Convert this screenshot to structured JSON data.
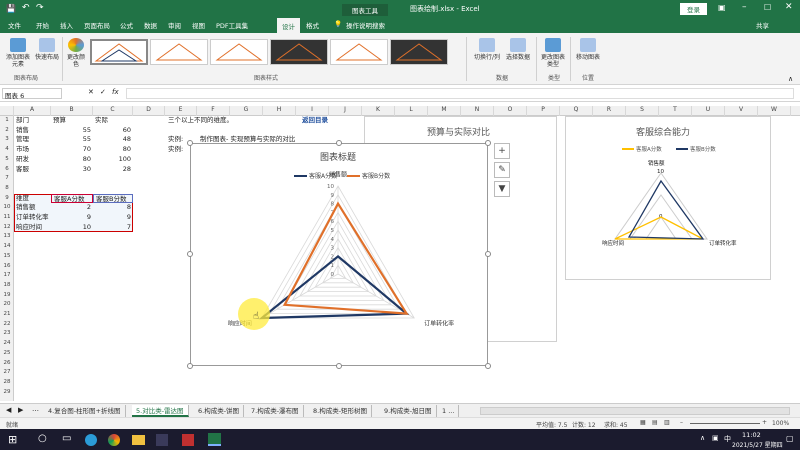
{
  "title_bar": {
    "context_tab": "图表工具",
    "filename": "图表绘制.xlsx - Excel",
    "login": "登录"
  },
  "tabs": [
    "文件",
    "开始",
    "插入",
    "页面布局",
    "公式",
    "数据",
    "审阅",
    "视图",
    "PDF工具集",
    "设计",
    "格式"
  ],
  "tell_me": "操作说明搜索",
  "share": "共享",
  "ribbon": {
    "add_element": "添加图表元素",
    "quick_layout": "快速布局",
    "change_color": "更改颜色",
    "group_layout": "图表布局",
    "group_styles": "图表样式",
    "switch_rowcol": "切换行/列",
    "select_data": "选择数据",
    "group_data": "数据",
    "change_type": "更改图表类型",
    "group_type": "类型",
    "move_chart": "移动图表",
    "group_location": "位置"
  },
  "name_box": "图表 6",
  "fx": "fx",
  "columns": [
    "A",
    "B",
    "C",
    "D",
    "E",
    "F",
    "G",
    "H",
    "I",
    "J",
    "K",
    "L",
    "M",
    "N",
    "O",
    "P",
    "Q",
    "R",
    "S",
    "T",
    "U",
    "V",
    "W"
  ],
  "rows": [
    "1",
    "2",
    "3",
    "4",
    "5",
    "6",
    "7",
    "8",
    "9",
    "10",
    "11",
    "12",
    "13",
    "14",
    "15",
    "16",
    "17",
    "18",
    "19",
    "20",
    "21",
    "22",
    "23",
    "24",
    "25",
    "26",
    "27",
    "28",
    "29"
  ],
  "table1": {
    "headers": [
      "部门",
      "预算",
      "实际"
    ],
    "rows": [
      [
        "销售",
        "55",
        "60"
      ],
      [
        "管理",
        "55",
        "48"
      ],
      [
        "市场",
        "70",
        "80"
      ],
      [
        "研发",
        "80",
        "100"
      ],
      [
        "客服",
        "30",
        "28"
      ]
    ]
  },
  "table2": {
    "headers": [
      "维度",
      "客服A分数",
      "客服B分数"
    ],
    "rows": [
      [
        "销售额",
        "2",
        "8"
      ],
      [
        "订单转化率",
        "9",
        "9"
      ],
      [
        "响应时间",
        "10",
        "7"
      ]
    ]
  },
  "notes": {
    "line1": "三个以上不同的维度。",
    "return_link": "返回目录",
    "example1_label": "实例:",
    "example1_text": "制作图表- 实现预算与实际的对比",
    "example2_label": "实例:"
  },
  "bg_chart1_title": "预算与实际对比",
  "bg_chart2": {
    "title": "客服综合能力",
    "legend_a": "客服A分数",
    "legend_b": "客服B分数",
    "axis_top": "销售额",
    "axis_right": "订单转化率",
    "axis_left": "响应时间",
    "tick_max": "10",
    "tick_min": "0"
  },
  "chart_data": {
    "type": "radar",
    "title": "图表标题",
    "categories": [
      "销售额",
      "订单转化率",
      "响应时间"
    ],
    "series": [
      {
        "name": "客服A分数",
        "values": [
          2,
          9,
          10
        ],
        "color": "#1f3864"
      },
      {
        "name": "客服B分数",
        "values": [
          8,
          9,
          7
        ],
        "color": "#e0702a"
      }
    ],
    "ticks": [
      "0",
      "1",
      "2",
      "3",
      "4",
      "5",
      "6",
      "7",
      "8",
      "9",
      "10"
    ],
    "range": [
      0,
      10
    ],
    "legend_position": "top"
  },
  "side_buttons": [
    "+",
    "✎",
    "▼"
  ],
  "sheet_tabs": [
    "4.复合图-柱形图+折线图",
    "5.对比类-雷达图",
    "6.构成类-饼图",
    "7.构成类-瀑布图",
    "8.构成类-矩形树图",
    "9.构成类-旭日图",
    "1 ..."
  ],
  "active_sheet_index": 1,
  "status": {
    "ready": "就绪",
    "average": "平均值: 7.5",
    "count": "计数: 12",
    "sum": "求和: 45",
    "zoom": "100%"
  },
  "clock": {
    "time": "11:02",
    "date": "2021/5/27 星期四"
  }
}
